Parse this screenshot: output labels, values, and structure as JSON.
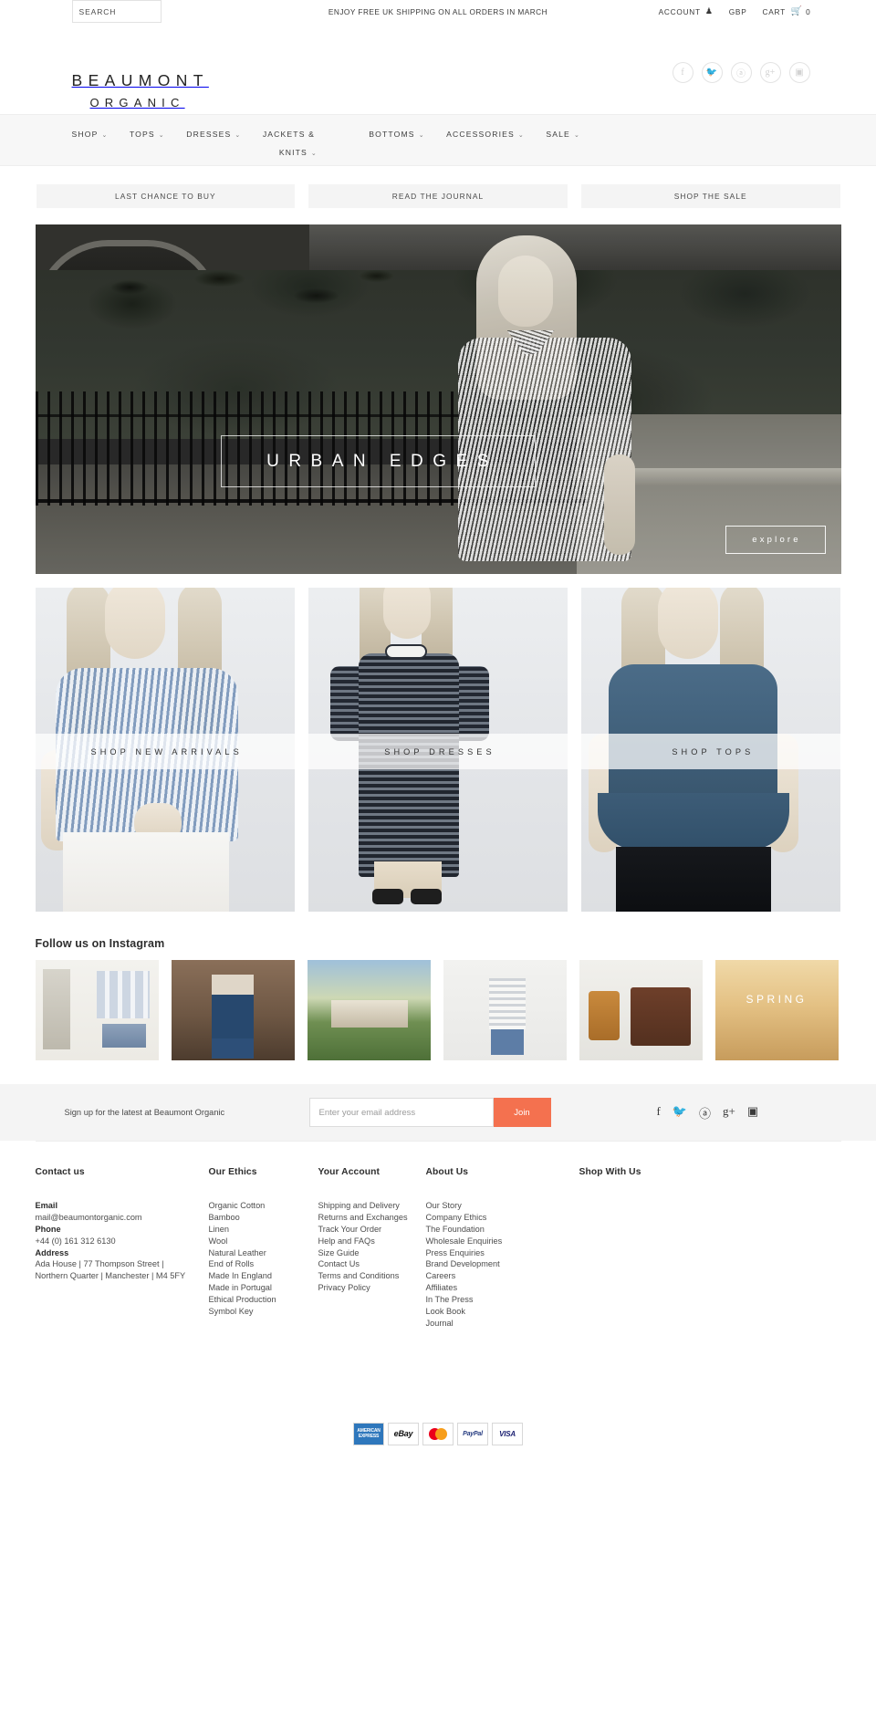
{
  "topbar": {
    "search_placeholder": "SEARCH",
    "promo_message": "ENJOY FREE UK SHIPPING ON ALL ORDERS IN MARCH",
    "account_label": "ACCOUNT",
    "account_icon": "person-icon",
    "currency_label": "GBP",
    "cart_label": "CART",
    "cart_icon": "shopping-cart-icon",
    "cart_count": "0"
  },
  "brand": {
    "line1": "BEAUMONT",
    "line2": "ORGANIC"
  },
  "social_top": [
    {
      "name": "facebook-icon",
      "glyph": "f"
    },
    {
      "name": "twitter-icon",
      "glyph": "ᴠ"
    },
    {
      "name": "pinterest-icon",
      "glyph": "ⓟ"
    },
    {
      "name": "googleplus-icon",
      "glyph": "g+"
    },
    {
      "name": "instagram-icon",
      "glyph": "▣"
    }
  ],
  "nav": [
    {
      "label": "SHOP",
      "caret": "⌄"
    },
    {
      "label": "TOPS",
      "caret": "⌄"
    },
    {
      "label": "DRESSES",
      "caret": "⌄"
    },
    {
      "label": "JACKETS &",
      "label2": "KNITS",
      "caret": "⌄"
    },
    {
      "label": "BOTTOMS",
      "caret": "⌄"
    },
    {
      "label": "ACCESSORIES",
      "caret": "⌄"
    },
    {
      "label": "SALE",
      "caret": "⌄"
    }
  ],
  "promo_buttons": [
    {
      "label": "LAST CHANCE TO BUY"
    },
    {
      "label": "READ THE JOURNAL"
    },
    {
      "label": "SHOP THE SALE"
    }
  ],
  "hero": {
    "title": "URBAN EDGES",
    "cta": "explore"
  },
  "tiles": [
    {
      "label": "SHOP NEW ARRIVALS"
    },
    {
      "label": "SHOP DRESSES"
    },
    {
      "label": "SHOP TOPS"
    }
  ],
  "instagram": {
    "heading": "Follow us on Instagram",
    "cells": [
      {
        "name": "instagram-post-sketch"
      },
      {
        "name": "instagram-post-denim-outfit"
      },
      {
        "name": "instagram-post-manor-house"
      },
      {
        "name": "instagram-post-stripe-tee"
      },
      {
        "name": "instagram-post-leather-goods"
      },
      {
        "name": "instagram-post-spring",
        "caption": "SPRING"
      }
    ]
  },
  "newsletter": {
    "label": "Sign up for the latest at Beaumont Organic",
    "input_placeholder": "Enter your email address",
    "join_label": "Join",
    "accent_color": "#f4714f",
    "social": [
      {
        "name": "facebook-icon",
        "glyph": "f"
      },
      {
        "name": "twitter-icon",
        "glyph": "ᴠ"
      },
      {
        "name": "pinterest-icon",
        "glyph": "ⓟ"
      },
      {
        "name": "googleplus-icon",
        "glyph": "g⁺"
      },
      {
        "name": "instagram-icon",
        "glyph": "▣"
      }
    ]
  },
  "footer": {
    "contact": {
      "heading": "Contact us",
      "email_label": "Email",
      "email_value": "mail@beaumontorganic.com",
      "phone_label": "Phone",
      "phone_value": "+44 (0) 161 312 6130",
      "address_label": "Address",
      "address_line1": "Ada House | 77 Thompson Street |",
      "address_line2": "Northern Quarter | Manchester | M4 5FY"
    },
    "ethics": {
      "heading": "Our Ethics",
      "items": [
        "Organic Cotton",
        "Bamboo",
        "Linen",
        "Wool",
        "Natural Leather",
        "End of Rolls",
        "Made In England",
        "Made in Portugal",
        "Ethical Production",
        "Symbol Key"
      ]
    },
    "account": {
      "heading": "Your Account",
      "items": [
        "Shipping and Delivery",
        "Returns and Exchanges",
        "Track Your Order",
        "Help and FAQs",
        "Size Guide",
        "Contact Us",
        "Terms and Conditions",
        "Privacy Policy"
      ]
    },
    "about": {
      "heading": "About Us",
      "items": [
        "Our Story",
        "Company Ethics",
        "The Foundation",
        "Wholesale Enquiries",
        "Press Enquiries",
        "Brand Development",
        "Careers",
        "Affiliates",
        "In The Press",
        "Look Book",
        "Journal"
      ]
    },
    "shopwith": {
      "heading": "Shop With Us",
      "items": []
    }
  },
  "payments": [
    {
      "name": "amex-icon",
      "line1": "AMERICAN",
      "line2": "EXPRESS"
    },
    {
      "name": "ebay-icon",
      "label": "eBay"
    },
    {
      "name": "mastercard-icon",
      "label": ""
    },
    {
      "name": "paypal-icon",
      "label": "PayPal"
    },
    {
      "name": "visa-icon",
      "label": "VISA"
    }
  ]
}
